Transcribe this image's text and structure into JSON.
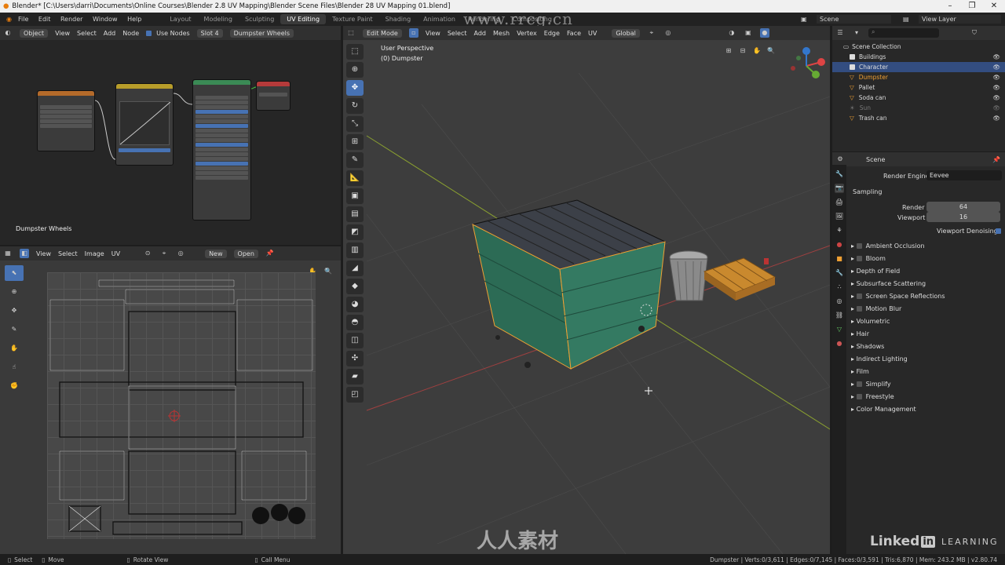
{
  "window": {
    "title": "Blender* [C:\\Users\\darri\\Documents\\Online Courses\\Blender 2.8 UV Mapping\\Blender Scene Files\\Blender 28 UV Mapping 01.blend]"
  },
  "menus": [
    "File",
    "Edit",
    "Render",
    "Window",
    "Help"
  ],
  "workspaces": [
    "Layout",
    "Modeling",
    "Sculpting",
    "UV Editing",
    "Texture Paint",
    "Shading",
    "Animation",
    "Rendering",
    "Compositing"
  ],
  "active_workspace": "UV Editing",
  "scene_label": "Scene",
  "view_layer_label": "View Layer",
  "node_editor": {
    "object_mode": "Object",
    "menu": [
      "View",
      "Select",
      "Add",
      "Node"
    ],
    "use_nodes": "Use Nodes",
    "slot": "Slot 4",
    "material": "Dumpster Wheels",
    "footer_label": "Dumpster Wheels"
  },
  "uv_editor": {
    "menu": [
      "View",
      "Select",
      "Image",
      "UV"
    ],
    "new": "New",
    "open": "Open"
  },
  "viewport": {
    "mode": "Edit Mode",
    "menu": [
      "View",
      "Select",
      "Add",
      "Mesh",
      "Vertex",
      "Edge",
      "Face",
      "UV"
    ],
    "orientation": "Global",
    "overlay_title": "User Perspective",
    "overlay_object": "(0) Dumpster"
  },
  "outliner": {
    "collection": "Scene Collection",
    "items": [
      "Buildings",
      "Character",
      "Dumpster",
      "Pallet",
      "Soda can",
      "Sun",
      "Trash can"
    ]
  },
  "properties": {
    "scene": "Scene",
    "render_engine_label": "Render Engine",
    "render_engine": "Eevee",
    "sampling": "Sampling",
    "render_label": "Render",
    "render_value": "64",
    "viewport_label": "Viewport",
    "viewport_value": "16",
    "denoise": "Viewport Denoising",
    "sections": [
      "Ambient Occlusion",
      "Bloom",
      "Depth of Field",
      "Subsurface Scattering",
      "Screen Space Reflections",
      "Motion Blur",
      "Volumetric",
      "Hair",
      "Shadows",
      "Indirect Lighting",
      "Film",
      "Simplify",
      "Freestyle",
      "Color Management"
    ]
  },
  "status": {
    "select": "Select",
    "move": "Move",
    "rotate": "Rotate View",
    "call_menu": "Call Menu",
    "stats": "Dumpster | Verts:0/3,611 | Edges:0/7,145 | Faces:0/3,591 | Tris:6,870 | Mem: 243.2 MB | v2.80.74"
  },
  "watermarks": {
    "site": "www.rrcg.cn",
    "brand_cn": "人人素材",
    "linkedin": "Linked",
    "learning": "LEARNING"
  },
  "colors": {
    "accent": "#4772b3",
    "selected_object": "#f0a033",
    "dumpster": "#2c6b55",
    "header": "#303030"
  }
}
